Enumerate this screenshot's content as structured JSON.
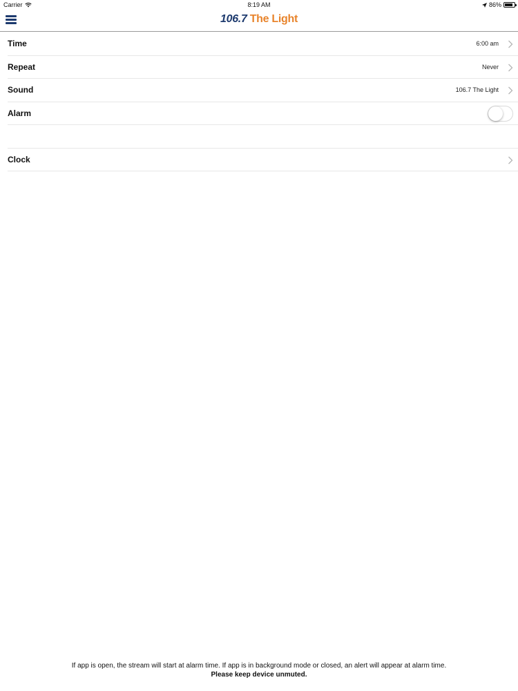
{
  "status_bar": {
    "carrier": "Carrier",
    "time": "8:19 AM",
    "battery_percent": "86%",
    "battery_level": 0.86,
    "icons": [
      "wifi-icon",
      "location-arrow-icon",
      "battery-icon"
    ]
  },
  "header": {
    "menu_icon": "hamburger-menu-icon",
    "logo_number": "106.7",
    "logo_name": "The Light",
    "colors": {
      "logo_number": "#1d3a6e",
      "logo_name": "#e8842c",
      "menu": "#1d3a6e"
    }
  },
  "settings": {
    "rows": [
      {
        "label": "Time",
        "value": "6:00 am"
      },
      {
        "label": "Repeat",
        "value": "Never"
      },
      {
        "label": "Sound",
        "value": "106.7 The Light"
      },
      {
        "label": "Alarm",
        "toggle_on": false
      }
    ],
    "clock_label": "Clock"
  },
  "footer": {
    "note": "If app is open, the stream will start at alarm time. If app is in background mode or closed, an alert will appear at alarm time.",
    "warning": "Please keep device unmuted."
  }
}
